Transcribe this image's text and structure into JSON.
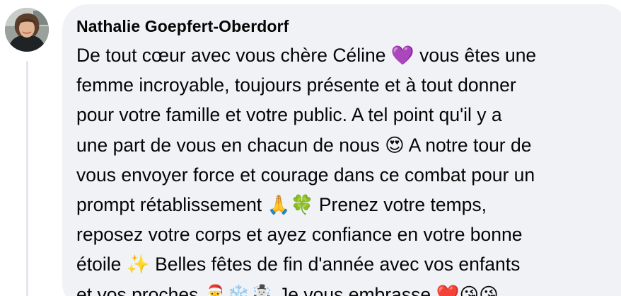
{
  "comment": {
    "author": "Nathalie Goepfert-Oberdorf",
    "lines": [
      "De tout cœur avec vous chère Céline 💜 vous êtes une",
      "femme incroyable, toujours présente et à tout donner",
      "pour votre famille et votre public. A tel point qu'il y a",
      "une part de vous en chacun de nous 😍 A notre tour de",
      "vous envoyer force et courage dans ce combat pour un",
      "prompt rétablissement 🙏🍀 Prenez votre temps,",
      "reposez votre corps et ayez confiance en votre bonne",
      "étoile ✨ Belles fêtes de fin d'année avec vos enfants",
      "et vos proches 🎅❄️☃️ Je vous embrasse ❤️😘😘"
    ]
  },
  "colors": {
    "bubble": "#f0f2f5",
    "text": "#050505",
    "thread_line": "#e4e6eb"
  }
}
